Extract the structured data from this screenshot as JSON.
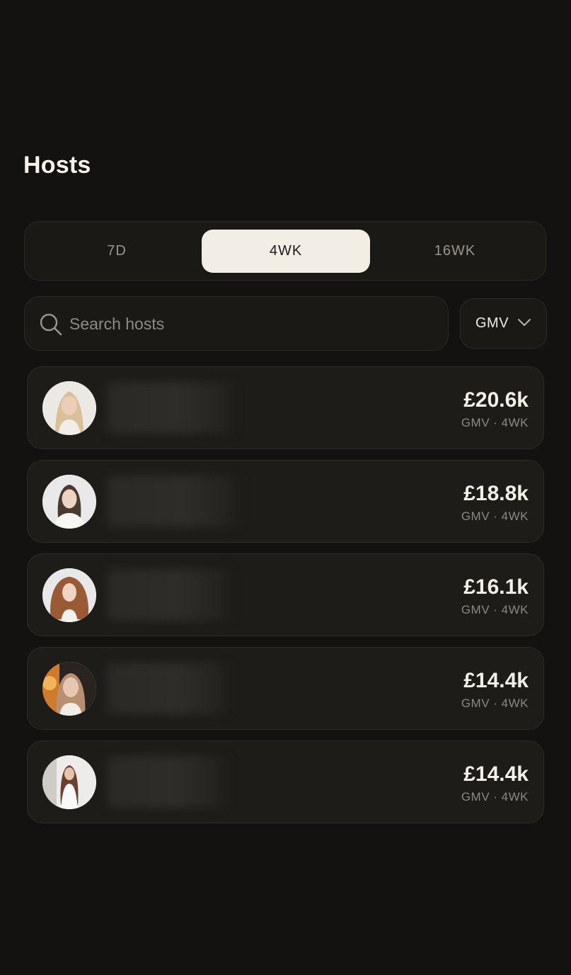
{
  "header": {
    "title": "Hosts"
  },
  "tabs": [
    {
      "label": "7D",
      "active": false
    },
    {
      "label": "4WK",
      "active": true
    },
    {
      "label": "16WK",
      "active": false
    }
  ],
  "search": {
    "placeholder": "Search hosts",
    "value": ""
  },
  "sort": {
    "label": "GMV",
    "icon": "chevron-down-icon"
  },
  "hosts": [
    {
      "amount": "£20.6k",
      "meta": "GMV · 4WK",
      "avatar": "avatar-blonde"
    },
    {
      "amount": "£18.8k",
      "meta": "GMV · 4WK",
      "avatar": "avatar-dark-hair"
    },
    {
      "amount": "£16.1k",
      "meta": "GMV · 4WK",
      "avatar": "avatar-curly"
    },
    {
      "amount": "£14.4k",
      "meta": "GMV · 4WK",
      "avatar": "avatar-warm"
    },
    {
      "amount": "£14.4k",
      "meta": "GMV · 4WK",
      "avatar": "avatar-brunette"
    }
  ],
  "colors": {
    "background": "#131210",
    "card": "#1d1c19",
    "active_tab": "#f3eee5",
    "muted_text": "#8d887f"
  }
}
